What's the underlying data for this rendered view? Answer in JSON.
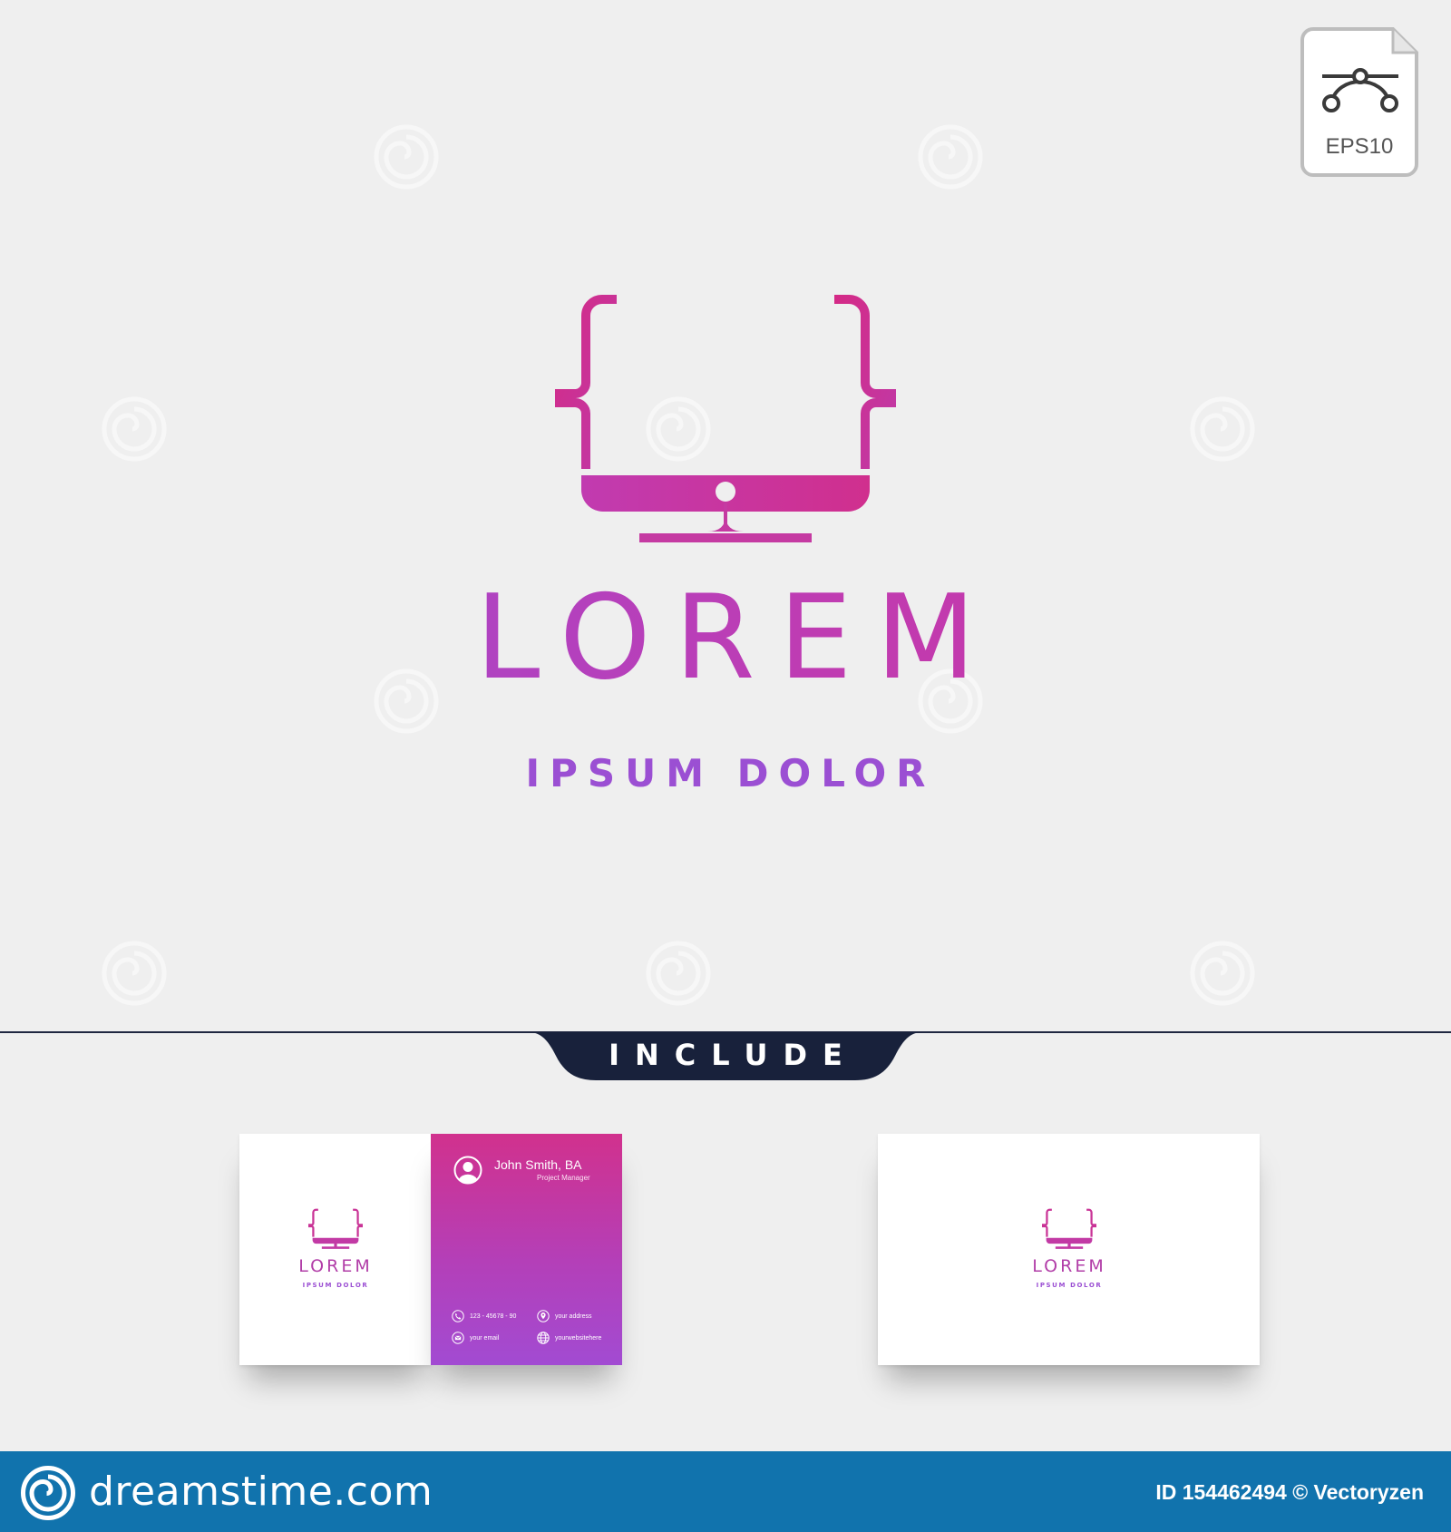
{
  "badge": {
    "label": "EPS10",
    "icon": "bezier-curve-icon"
  },
  "logo": {
    "icon": "monitor-braces-icon",
    "title": "LOREM",
    "subtitle": "IPSUM DOLOR",
    "colors": {
      "pink": "#d42a86",
      "purple": "#9b4fd3",
      "magenta": "#c13bb0"
    }
  },
  "include": {
    "label": "INCLUDE",
    "pill_color": "#18213b"
  },
  "business_card": {
    "front_logo_title": "LOREM",
    "front_logo_subtitle": "IPSUM DOLOR",
    "name": "John Smith, BA",
    "role": "Project Manager",
    "phone": "123 - 45678 - 90",
    "address": "your address",
    "email": "your email",
    "website": "yourwebsitehere",
    "back_logo_title": "LOREM",
    "back_logo_subtitle": "IPSUM DOLOR"
  },
  "footer": {
    "brand": "dreamstime.com",
    "id_text": "ID 154462494 © Vectoryzen",
    "bg_color": "#1173ad"
  }
}
